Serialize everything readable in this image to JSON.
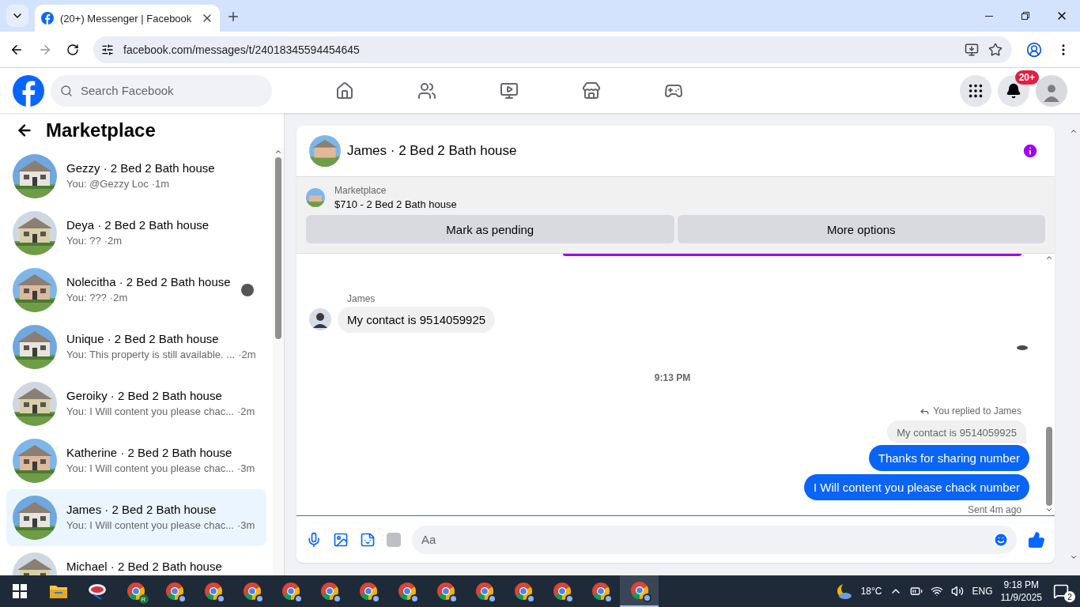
{
  "browser": {
    "tab_title": "(20+) Messenger | Facebook",
    "url": "facebook.com/messages/t/24018345594454645"
  },
  "header": {
    "search_placeholder": "Search Facebook",
    "notification_badge": "20+"
  },
  "sidebar": {
    "title": "Marketplace",
    "conversations": [
      {
        "name": "Gezzy · 2 Bed 2 Bath house",
        "preview": "You: @Gezzy Loc",
        "time": "·1m",
        "selected": false,
        "seen_avatar": false
      },
      {
        "name": "Deya · 2 Bed 2 Bath house",
        "preview": "You: ??",
        "time": "·2m",
        "selected": false,
        "seen_avatar": false
      },
      {
        "name": "Nolecitha · 2 Bed 2 Bath house",
        "preview": "You: ???",
        "time": "·2m",
        "selected": false,
        "seen_avatar": true
      },
      {
        "name": "Unique · 2 Bed 2 Bath house",
        "preview": "You: This property is still available. ...",
        "time": "·2m",
        "selected": false,
        "seen_avatar": false
      },
      {
        "name": "Geroiky · 2 Bed 2 Bath house",
        "preview": "You: I Will content you please chac...",
        "time": "·2m",
        "selected": false,
        "seen_avatar": false
      },
      {
        "name": "Katherine · 2 Bed 2 Bath house",
        "preview": "You: I Will content you please chac...",
        "time": "·3m",
        "selected": false,
        "seen_avatar": false
      },
      {
        "name": "James · 2 Bed 2 Bath house",
        "preview": "You: I Will content you please chac...",
        "time": "·3m",
        "selected": true,
        "seen_avatar": false
      },
      {
        "name": "Michael · 2 Bed 2 Bath house",
        "selected": false,
        "seen_avatar": false
      }
    ]
  },
  "chat": {
    "title": "James · 2 Bed 2 Bath house",
    "listing": {
      "label": "Marketplace",
      "title": "$710 - 2 Bed 2 Bath house",
      "buttons": [
        "Mark as pending",
        "More options"
      ]
    },
    "messages": [
      {
        "kind": "cut_bubble"
      },
      {
        "kind": "received",
        "sender": "James",
        "text": "My contact is 9514059925"
      },
      {
        "kind": "seen"
      },
      {
        "kind": "timestamp",
        "text": "9:13 PM"
      },
      {
        "kind": "reply_note",
        "text": "You replied to James"
      },
      {
        "kind": "quoted",
        "text": "My contact is 9514059925"
      },
      {
        "kind": "sent",
        "text": "Thanks for sharing number"
      },
      {
        "kind": "sent",
        "text": "I Will content you please chack number"
      },
      {
        "kind": "status",
        "text": "Sent 4m ago"
      }
    ],
    "composer": {
      "placeholder": "Aa"
    }
  },
  "taskbar": {
    "apps": [
      {
        "kind": "explorer",
        "selected": false
      },
      {
        "kind": "app",
        "selected": false
      },
      {
        "kind": "chrome",
        "badge": "R",
        "selected": false
      },
      {
        "kind": "chrome",
        "selected": false
      },
      {
        "kind": "chrome",
        "selected": false
      },
      {
        "kind": "chrome",
        "selected": false
      },
      {
        "kind": "chrome",
        "selected": false
      },
      {
        "kind": "chrome",
        "selected": false
      },
      {
        "kind": "chrome",
        "selected": false
      },
      {
        "kind": "chrome",
        "selected": false
      },
      {
        "kind": "chrome",
        "selected": false
      },
      {
        "kind": "chrome",
        "selected": false
      },
      {
        "kind": "chrome",
        "selected": false
      },
      {
        "kind": "chrome",
        "selected": false
      },
      {
        "kind": "chrome",
        "selected": false
      },
      {
        "kind": "chrome",
        "selected": true
      }
    ],
    "temperature": "18°C",
    "language": "ENG",
    "time": "9:18 PM",
    "date": "11/9/2025",
    "notifications": "2"
  }
}
